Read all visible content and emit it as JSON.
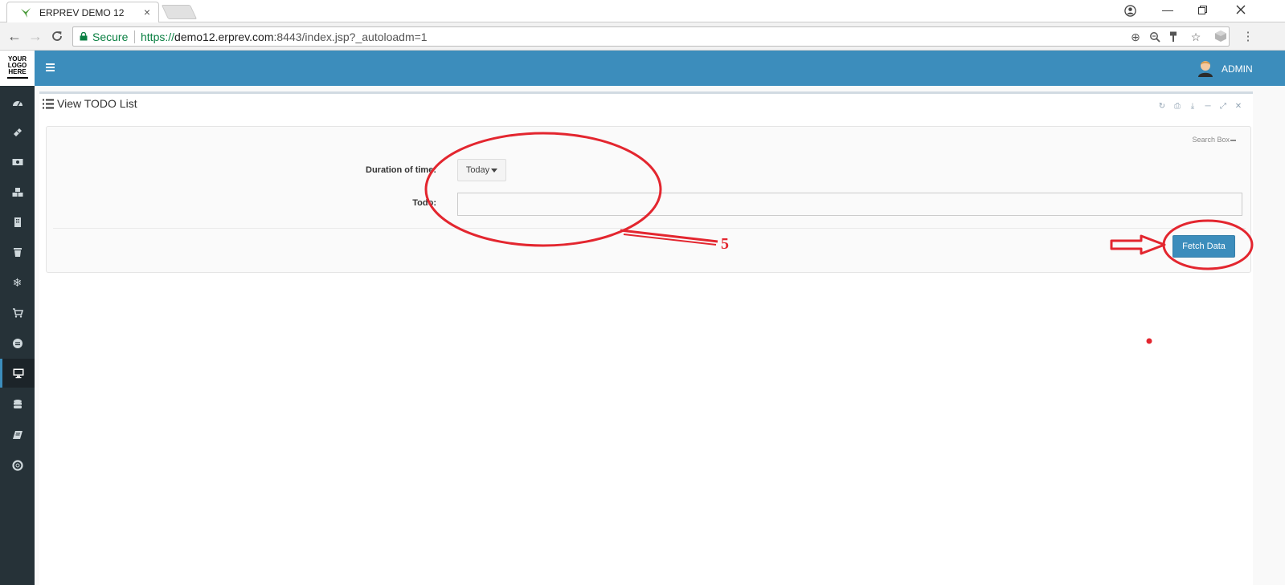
{
  "browser": {
    "tab_title": "ERPREV DEMO 12",
    "tab_close": "×",
    "secure_label": "Secure",
    "url_protocol": "https://",
    "url_host": "demo12.erprev.com",
    "url_path": ":8443/index.jsp?_autoloadm=1"
  },
  "logo": {
    "line1": "YOUR",
    "line2": "LOGO",
    "line3": "HERE"
  },
  "header": {
    "user_label": "ADMIN"
  },
  "portlet": {
    "title": "View TODO List"
  },
  "search": {
    "caption": "Search Box",
    "duration_label": "Duration of time:",
    "duration_value": "Today",
    "todo_label": "Todo:",
    "todo_value": "",
    "fetch_label": "Fetch Data"
  },
  "annotation": {
    "step_number": "5",
    "color": "#e3262f"
  },
  "colors": {
    "header": "#3c8dbc",
    "rail": "#263238",
    "button": "#3c8dbc"
  }
}
